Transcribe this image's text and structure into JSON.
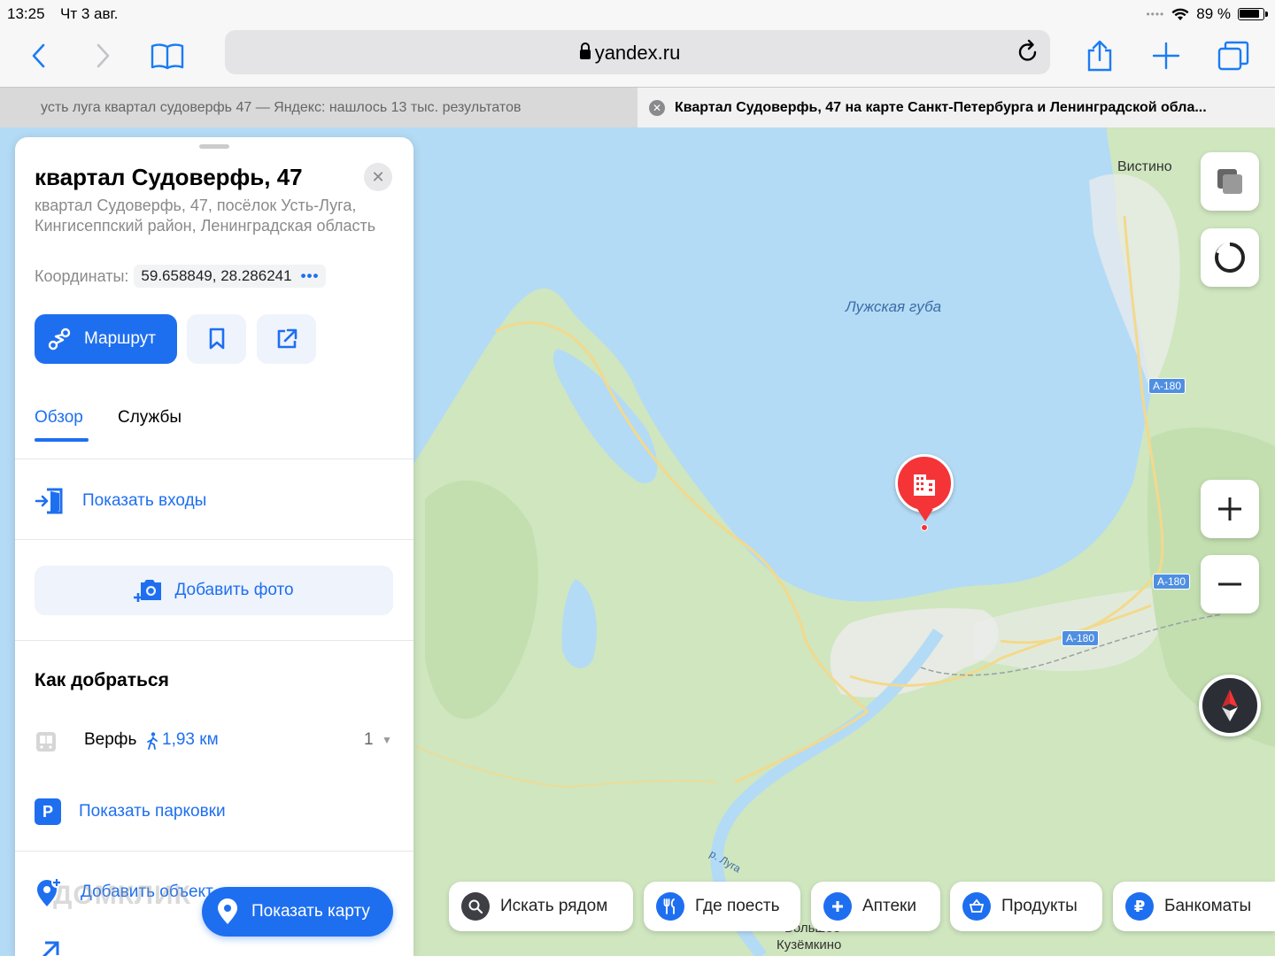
{
  "status": {
    "time": "13:25",
    "date": "Чт 3 авг.",
    "battery": "89 %"
  },
  "browser": {
    "url": "yandex.ru"
  },
  "tabs": [
    {
      "title": "усть луга квартал судоверфь 47 — Яндекс: нашлось 13 тыс. результатов"
    },
    {
      "title": "Квартал Судоверфь, 47 на карте Санкт-Петербурга и Ленинградской обла..."
    }
  ],
  "panel": {
    "title": "квартал Судоверфь, 47",
    "address": "квартал Судоверфь, 47, посёлок Усть-Луга, Кингисеппский район, Ленинградская область",
    "coords_label": "Координаты:",
    "coords_value": "59.658849, 28.286241",
    "route_label": "Маршрут",
    "tab_overview": "Обзор",
    "tab_services": "Службы",
    "show_entrances": "Показать входы",
    "add_photo": "Добавить фото",
    "how_to_get": "Как добраться",
    "stop_name": "Верфь",
    "stop_distance": "1,93 км",
    "stop_count": "1",
    "show_parking": "Показать парковки",
    "add_object": "Добавить объект",
    "show_map": "Показать карту",
    "watermark": "ДОМКЛИК"
  },
  "map": {
    "labels": {
      "vistino": "Вистино",
      "bay": "Лужская губа",
      "river": "р. Луга",
      "village1": "Большое",
      "village2": "Кузёмкино"
    },
    "roads": [
      "А-180",
      "А-180",
      "А-180"
    ]
  },
  "chips": [
    {
      "label": "Искать рядом",
      "color": "#3d3f44"
    },
    {
      "label": "Где поесть",
      "color": "#1e6ff0"
    },
    {
      "label": "Аптеки",
      "color": "#1e6ff0"
    },
    {
      "label": "Продукты",
      "color": "#1e6ff0"
    },
    {
      "label": "Банкоматы",
      "color": "#1e6ff0"
    }
  ],
  "colors": {
    "accent": "#1e6ff0",
    "pin": "#f43437",
    "water": "#b4dbf5",
    "land": "#cfe6bf"
  }
}
